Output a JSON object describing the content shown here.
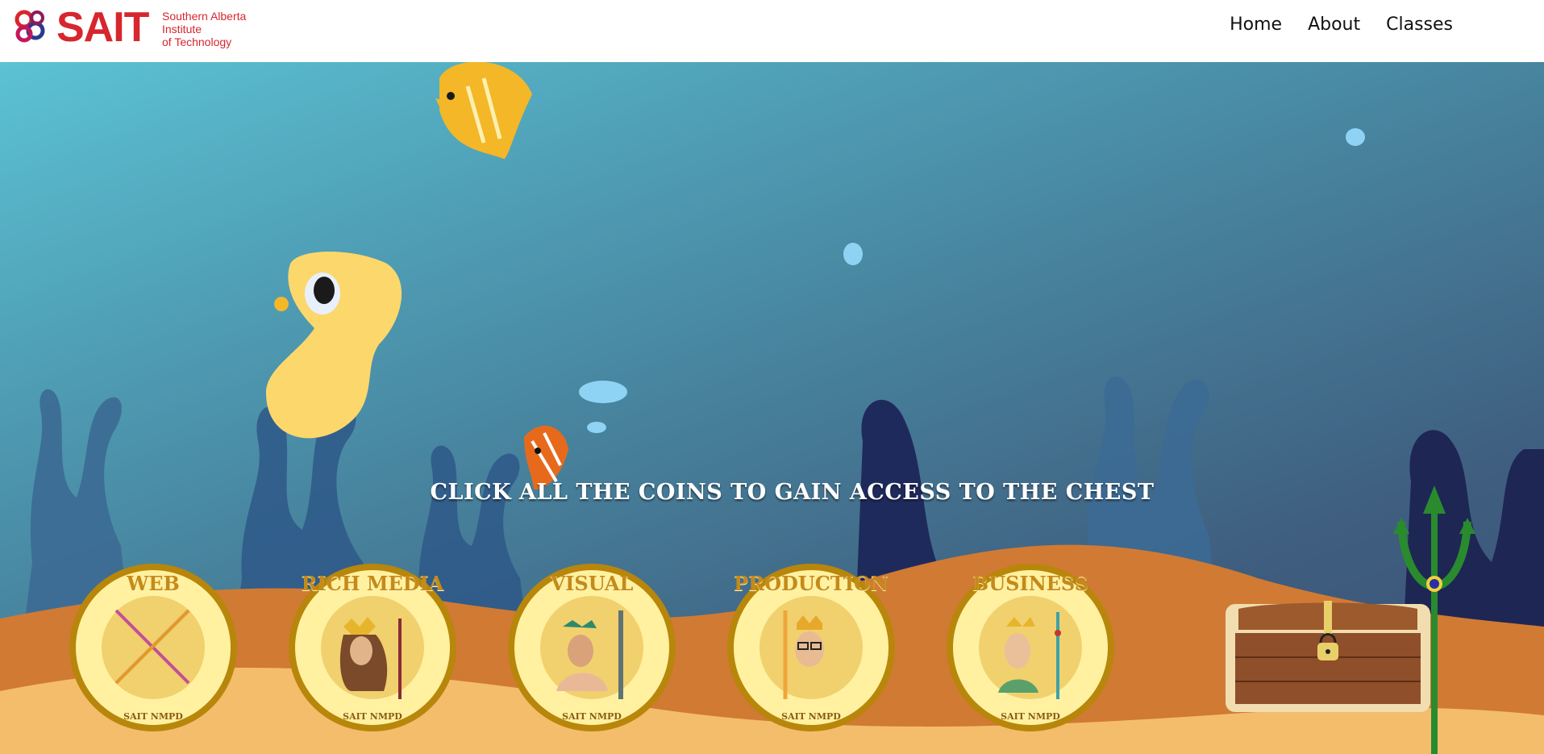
{
  "brand": {
    "name": "SAIT",
    "subtitle": "Southern Alberta\nInstitute\nof Technology",
    "color": "#d7262e"
  },
  "nav": {
    "items": [
      {
        "label": "Home"
      },
      {
        "label": "About"
      },
      {
        "label": "Classes"
      }
    ]
  },
  "game": {
    "instruction": "CLICK ALL THE COINS TO GAIN ACCESS TO THE CHEST",
    "coins": [
      {
        "title": "WEB",
        "sub": "SAIT NMPD",
        "icon": "crossed-tridents-icon"
      },
      {
        "title": "RICH MEDIA",
        "sub": "SAIT NMPD",
        "icon": "queen-with-trident-icon"
      },
      {
        "title": "VISUAL",
        "sub": "SAIT NMPD",
        "icon": "king-with-trident-icon"
      },
      {
        "title": "PRODUCTION",
        "sub": "SAIT NMPD",
        "icon": "glasses-king-icon"
      },
      {
        "title": "BUSINESS",
        "sub": "SAIT NMPD",
        "icon": "blonde-king-icon"
      }
    ],
    "chest_state": "locked",
    "colors": {
      "coin_gold": "#e2b84a",
      "sand_dark": "#d17a34",
      "sand_light": "#f4bd6b",
      "trident": "#2a8a2e"
    }
  }
}
